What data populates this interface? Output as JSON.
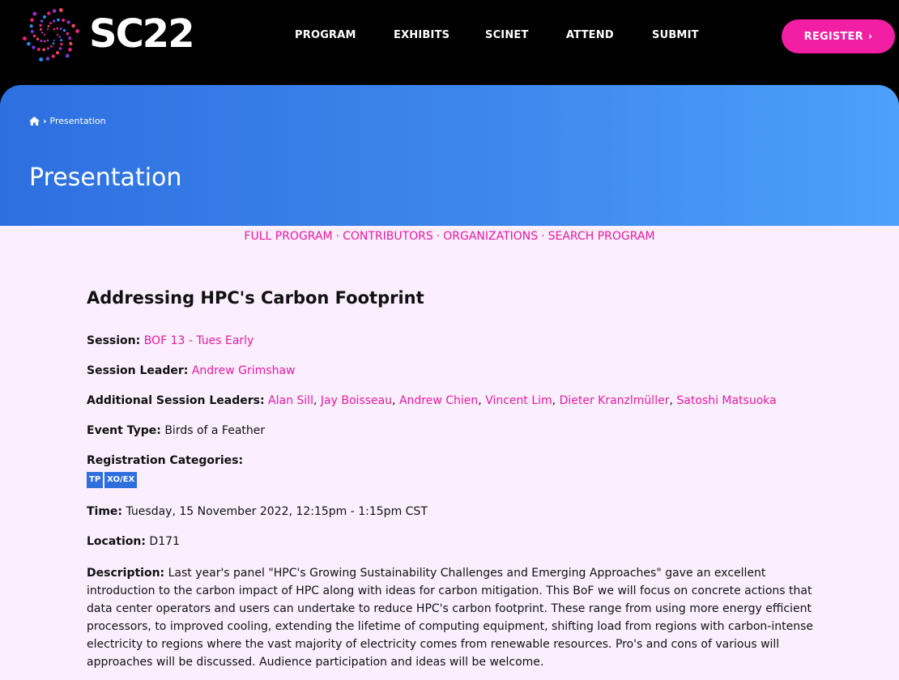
{
  "header": {
    "logo_text": "SC22",
    "nav": [
      "PROGRAM",
      "EXHIBITS",
      "SCINET",
      "ATTEND",
      "SUBMIT"
    ],
    "register_label": "REGISTER",
    "colors": {
      "accent": "#f21ea3",
      "hero": "#3f8aee"
    }
  },
  "breadcrumb": {
    "current": "Presentation"
  },
  "hero_title": "Presentation",
  "subnav": [
    "FULL PROGRAM",
    "CONTRIBUTORS",
    "ORGANIZATIONS",
    "SEARCH PROGRAM"
  ],
  "presentation": {
    "title": "Addressing HPC's Carbon Footprint",
    "session_label": "Session:",
    "session_value": "BOF 13 - Tues Early",
    "leader_label": "Session Leader:",
    "leader_value": "Andrew Grimshaw",
    "additional_label": "Additional Session Leaders:",
    "additional_leaders": [
      "Alan Sill",
      "Jay Boisseau",
      "Andrew Chien",
      "Vincent Lim",
      "Dieter Kranzlmüller",
      "Satoshi Matsuoka"
    ],
    "event_type_label": "Event Type:",
    "event_type_value": "Birds of a Feather",
    "registration_label": "Registration Categories:",
    "registration_tags": [
      "TP",
      "XO/EX"
    ],
    "time_label": "Time:",
    "time_value": "Tuesday, 15 November 2022, 12:15pm - 1:15pm CST",
    "location_label": "Location:",
    "location_value": "D171",
    "description_label": "Description:",
    "description_value": "Last year's panel \"HPC's Growing Sustainability Challenges and Emerging Approaches\" gave an excellent introduction to the carbon impact of HPC along with ideas for carbon mitigation. This BoF we will focus on concrete actions that data center operators and users can undertake to reduce HPC's carbon footprint. These range from using more energy efficient processors, to improved cooling, extending the lifetime of computing equipment, shifting load from regions with carbon-intense electricity to regions where the vast majority of electricity comes from renewable resources. Pro's and cons of various will approaches will be discussed. Audience participation and ideas will be welcome."
  }
}
